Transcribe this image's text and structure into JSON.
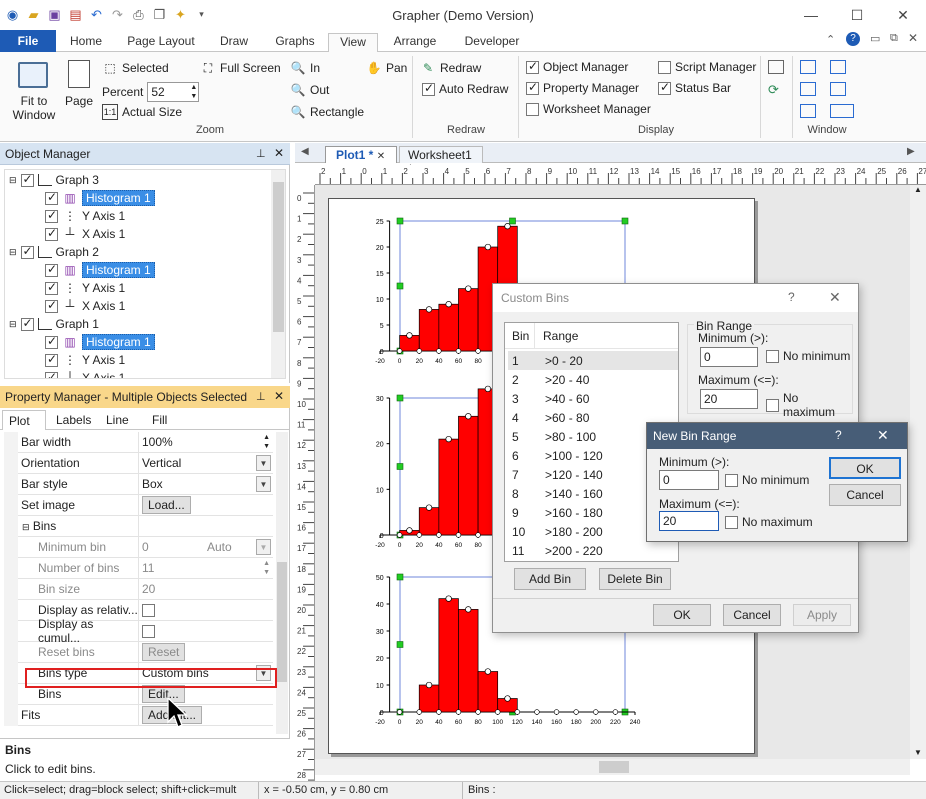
{
  "app": {
    "title": "Grapher (Demo Version)",
    "window_controls": {
      "minimize": "—",
      "maximize": "☐",
      "close": "✕"
    }
  },
  "ribbon_tabs": [
    "File",
    "Home",
    "Page Layout",
    "Draw",
    "Graphs",
    "View",
    "Arrange",
    "Developer"
  ],
  "ribbon": {
    "fit_to_window": "Fit to\nWindow",
    "page": "Page",
    "selected": "Selected",
    "full_screen": "Full Screen",
    "percent_label": "Percent",
    "percent_value": "52",
    "actual_size": "Actual Size",
    "zoom_in": "In",
    "zoom_out": "Out",
    "rectangle": "Rectangle",
    "pan": "Pan",
    "zoom_group": "Zoom",
    "redraw": "Redraw",
    "auto_redraw": "Auto Redraw",
    "redraw_group": "Redraw",
    "object_manager": "Object Manager",
    "property_manager": "Property Manager",
    "worksheet_manager": "Worksheet Manager",
    "script_manager": "Script Manager",
    "status_bar": "Status Bar",
    "display_group": "Display",
    "window_group": "Window"
  },
  "object_manager": {
    "title": "Object Manager",
    "graph3": "Graph 3",
    "graph2": "Graph 2",
    "graph1": "Graph 1",
    "histogram": "Histogram 1",
    "yaxis": "Y Axis 1",
    "xaxis": "X Axis 1"
  },
  "property_manager": {
    "title": "Property Manager - Multiple Objects Selected",
    "tabs": [
      "Plot",
      "Labels",
      "Line",
      "Fill"
    ],
    "rows": {
      "bar_width": {
        "label": "Bar width",
        "value": "100%"
      },
      "orientation": {
        "label": "Orientation",
        "value": "Vertical"
      },
      "bar_style": {
        "label": "Bar style",
        "value": "Box"
      },
      "set_image": {
        "label": "Set image",
        "value": "Load..."
      },
      "bins": {
        "label": "Bins"
      },
      "minimum_bin": {
        "label": "Minimum bin",
        "value": "0",
        "extra": "Auto"
      },
      "number_of_bins": {
        "label": "Number of bins",
        "value": "11"
      },
      "bin_size": {
        "label": "Bin size",
        "value": "20"
      },
      "display_relative": {
        "label": "Display as relativ..."
      },
      "display_cumulative": {
        "label": "Display as cumul..."
      },
      "reset_bins": {
        "label": "Reset bins",
        "value": "Reset"
      },
      "bins_type": {
        "label": "Bins type",
        "value": "Custom bins"
      },
      "bins_edit": {
        "label": "Bins",
        "value": "Edit..."
      },
      "fits": {
        "label": "Fits",
        "value": "Add Fit..."
      }
    },
    "help_title": "Bins",
    "help_text": "Click to edit bins."
  },
  "doc_tabs": [
    "Plot1 *",
    "Worksheet1 *"
  ],
  "custom_bins": {
    "title": "Custom Bins",
    "help": "?",
    "col_bin": "Bin",
    "col_range": "Range",
    "rows": [
      {
        "n": "1",
        "r": ">0 - 20"
      },
      {
        "n": "2",
        "r": ">20 - 40"
      },
      {
        "n": "3",
        "r": ">40 - 60"
      },
      {
        "n": "4",
        "r": ">60 - 80"
      },
      {
        "n": "5",
        "r": ">80 - 100"
      },
      {
        "n": "6",
        "r": ">100 - 120"
      },
      {
        "n": "7",
        "r": ">120 - 140"
      },
      {
        "n": "8",
        "r": ">140 - 160"
      },
      {
        "n": "9",
        "r": ">160 - 180"
      },
      {
        "n": "10",
        "r": ">180 - 200"
      },
      {
        "n": "11",
        "r": ">200 - 220"
      }
    ],
    "bin_range": "Bin Range",
    "minimum_label": "Minimum (>):",
    "minimum_value": "0",
    "no_minimum": "No minimum",
    "maximum_label": "Maximum (<=):",
    "maximum_value": "20",
    "no_maximum": "No maximum",
    "add_bin": "Add Bin",
    "delete_bin": "Delete Bin",
    "ok": "OK",
    "cancel": "Cancel",
    "apply": "Apply"
  },
  "new_bin_range": {
    "title": "New Bin Range",
    "help": "?",
    "minimum_label": "Minimum (>):",
    "minimum_value": "0",
    "no_minimum": "No minimum",
    "maximum_label": "Maximum (<=):",
    "maximum_value": "20",
    "no_maximum": "No maximum",
    "ok": "OK",
    "cancel": "Cancel"
  },
  "status": {
    "hint": "Click=select; drag=block select; shift+click=mult",
    "coords": "x = -0.50 cm, y = 0.80 cm",
    "bins": "Bins :"
  },
  "chart_data": [
    {
      "type": "bar",
      "name": "Graph 3",
      "x": [
        0,
        20,
        40,
        60,
        80,
        100
      ],
      "values": [
        3,
        8,
        9,
        12,
        20,
        24
      ],
      "xlim": [
        -20,
        240
      ],
      "ylim": [
        0,
        25
      ],
      "yticks": [
        0,
        5,
        10,
        15,
        20,
        25
      ],
      "color": "#ff0000"
    },
    {
      "type": "bar",
      "name": "Graph 2",
      "x": [
        0,
        20,
        40,
        60,
        80,
        100
      ],
      "values": [
        1,
        6,
        21,
        26,
        32,
        30
      ],
      "xlim": [
        -20,
        240
      ],
      "ylim": [
        0,
        30
      ],
      "yticks": [
        0,
        10,
        20,
        30
      ],
      "color": "#ff0000"
    },
    {
      "type": "bar",
      "name": "Graph 1",
      "x": [
        20,
        40,
        60,
        80,
        100
      ],
      "values": [
        10,
        42,
        38,
        15,
        5
      ],
      "xlim": [
        -20,
        240
      ],
      "ylim": [
        0,
        50
      ],
      "yticks": [
        0,
        10,
        20,
        30,
        40,
        50
      ],
      "xticks": [
        -20,
        0,
        20,
        40,
        60,
        80,
        100,
        120,
        140,
        160,
        180,
        200,
        220,
        240
      ],
      "color": "#ff0000"
    }
  ]
}
